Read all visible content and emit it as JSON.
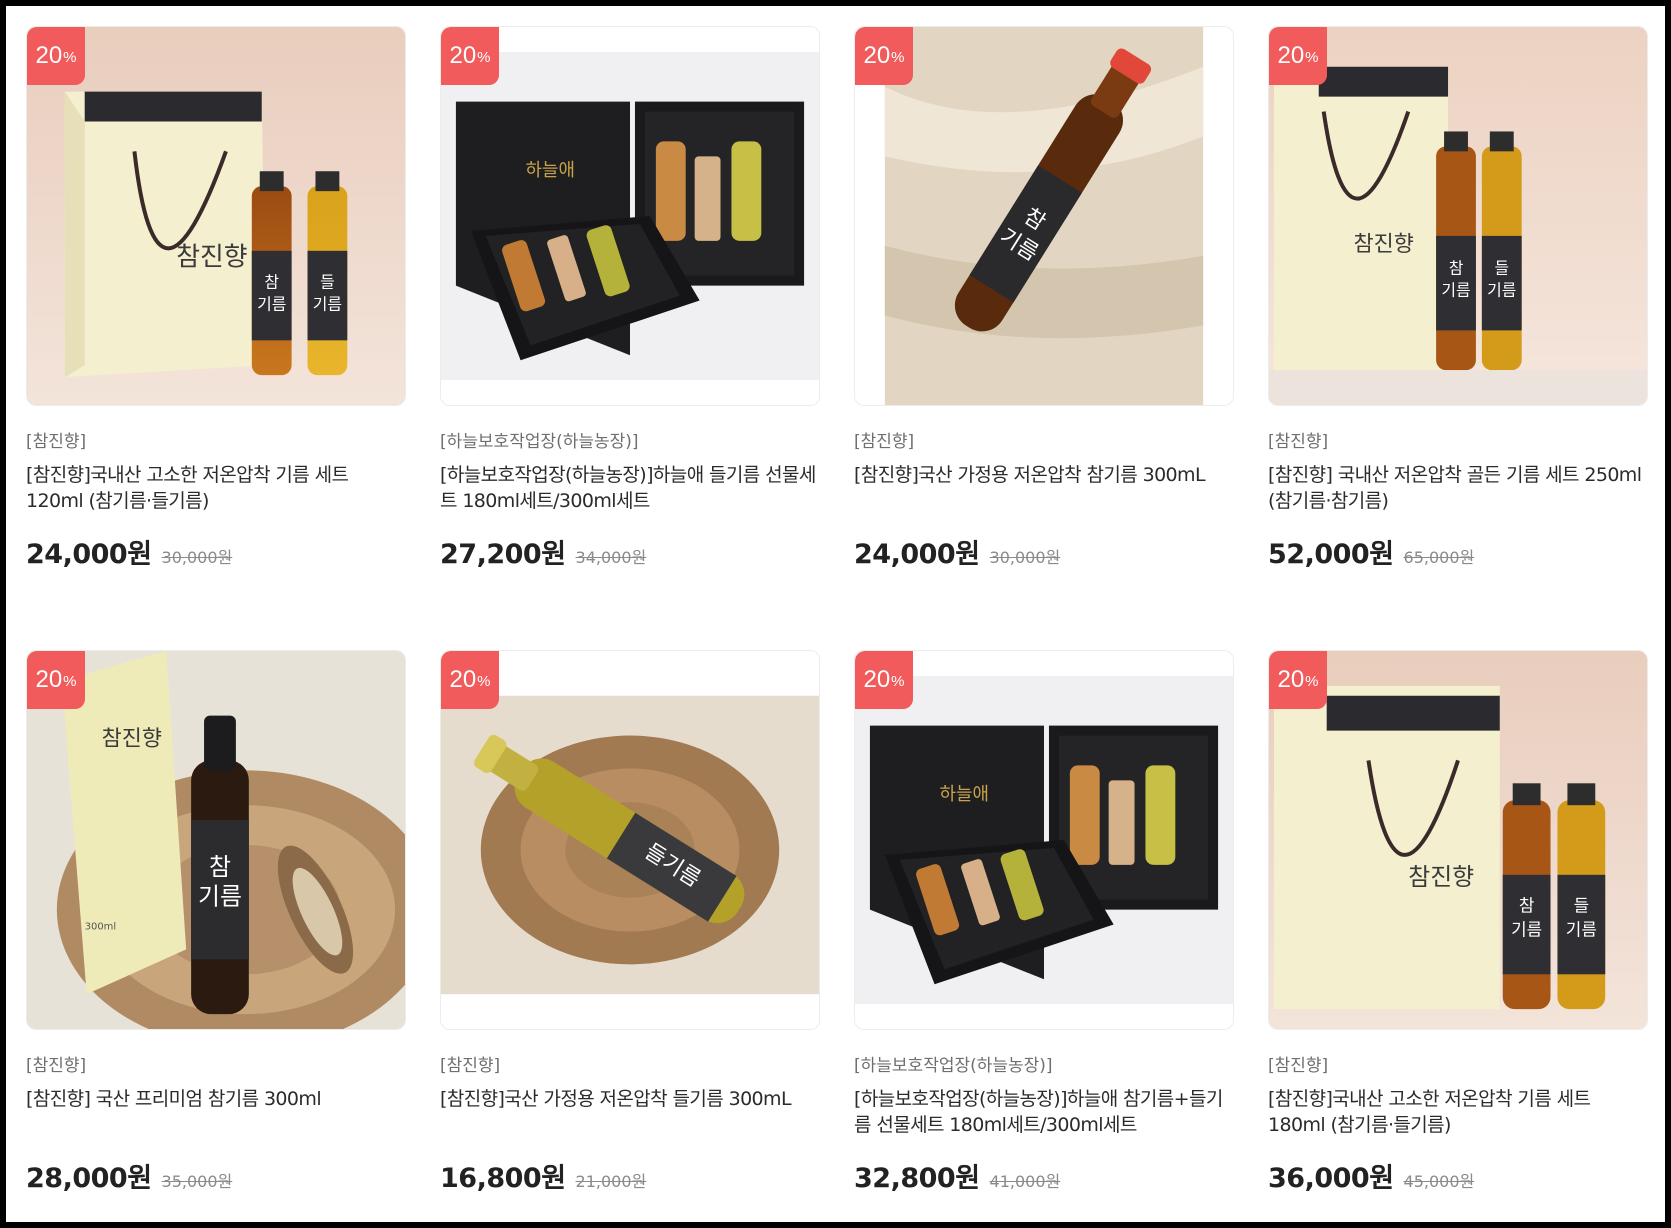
{
  "products": [
    {
      "badge": {
        "value": "20",
        "unit": "%"
      },
      "image": "gift-bag-two-bottles-image",
      "brand": "[참진향]",
      "title": "[참진향]국내산 고소한 저온압착 기름 세트 120ml (참기름·들기름)",
      "price": "24,000원",
      "original_price": "30,000원"
    },
    {
      "badge": {
        "value": "20",
        "unit": "%"
      },
      "image": "premium-gift-box-set-image",
      "brand": "[하늘보호작업장(하늘농장)]",
      "title": "[하늘보호작업장(하늘농장)]하늘애 들기름 선물세트 180ml세트/300ml세트",
      "price": "27,200원",
      "original_price": "34,000원"
    },
    {
      "badge": {
        "value": "20",
        "unit": "%"
      },
      "image": "sesame-oil-bottle-on-linen-image",
      "brand": "[참진향]",
      "title": "[참진향]국산 가정용 저온압착 참기름 300mL",
      "price": "24,000원",
      "original_price": "30,000원"
    },
    {
      "badge": {
        "value": "20",
        "unit": "%"
      },
      "image": "gift-bag-two-bottles-golden-image",
      "brand": "[참진향]",
      "title": "[참진향] 국내산 저온압착 골든 기름 세트 250ml (참기름·참기름)",
      "price": "52,000원",
      "original_price": "65,000원"
    },
    {
      "badge": {
        "value": "20",
        "unit": "%"
      },
      "image": "premium-sesame-oil-with-box-image",
      "brand": "[참진향]",
      "title": "[참진향] 국산 프리미엄 참기름 300ml",
      "price": "28,000원",
      "original_price": "35,000원"
    },
    {
      "badge": {
        "value": "20",
        "unit": "%"
      },
      "image": "perilla-oil-bottle-on-wood-image",
      "brand": "[참진향]",
      "title": "[참진향]국산 가정용 저온압착 들기름 300mL",
      "price": "16,800원",
      "original_price": "21,000원"
    },
    {
      "badge": {
        "value": "20",
        "unit": "%"
      },
      "image": "premium-gift-box-set-image",
      "brand": "[하늘보호작업장(하늘농장)]",
      "title": "[하늘보호작업장(하늘농장)]하늘애 참기름+들기름 선물세트 180ml세트/300ml세트",
      "price": "32,800원",
      "original_price": "41,000원"
    },
    {
      "badge": {
        "value": "20",
        "unit": "%"
      },
      "image": "gift-bag-two-bottles-image",
      "brand": "[참진향]",
      "title": "[참진향]국내산 고소한 저온압착 기름 세트 180ml (참기름·들기름)",
      "price": "36,000원",
      "original_price": "45,000원"
    }
  ],
  "colors": {
    "badge": "#f15b5b",
    "price": "#222222",
    "brand": "#6f6f6f"
  }
}
